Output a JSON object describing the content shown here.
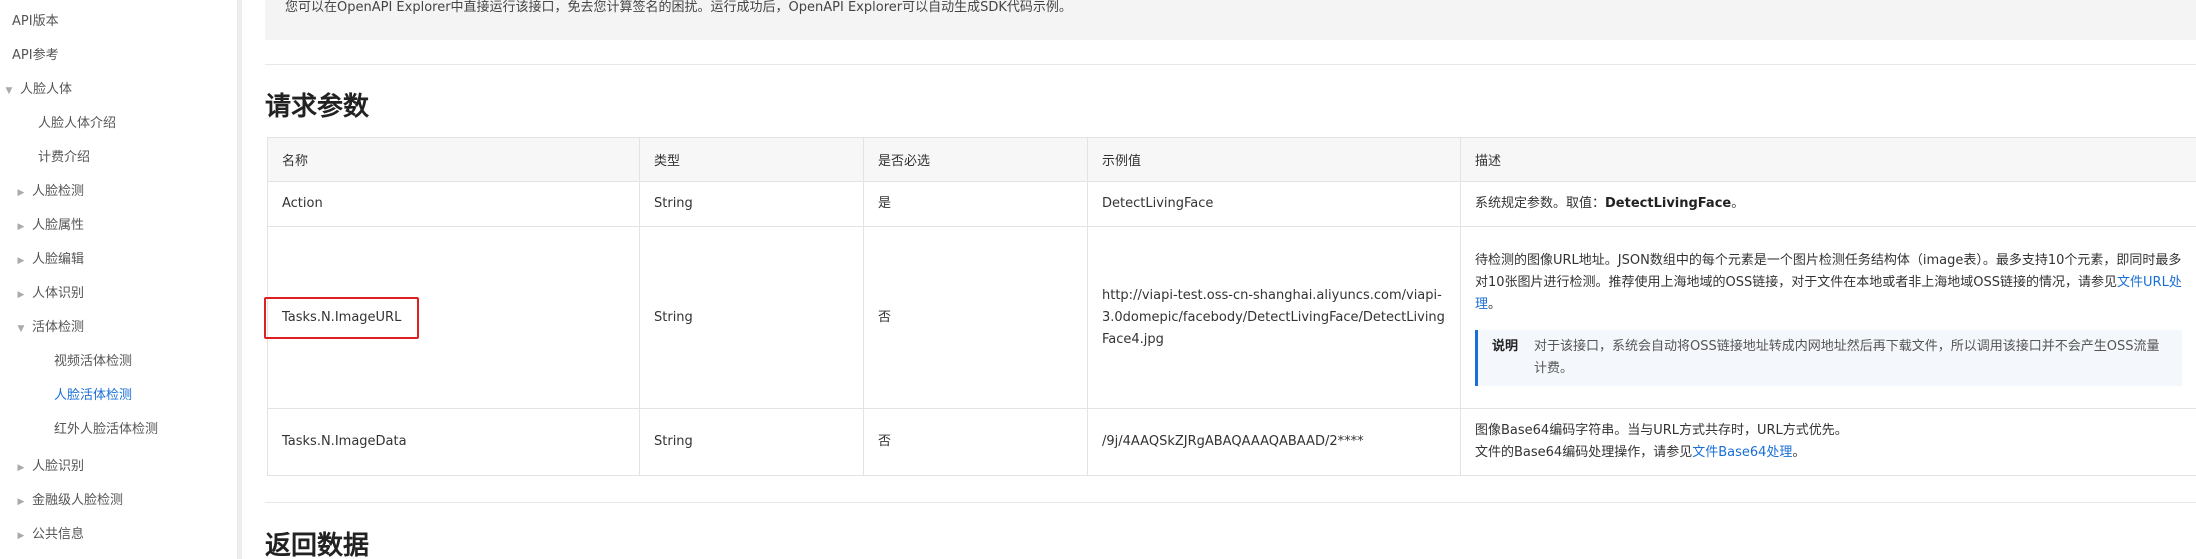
{
  "sidebar": {
    "items": [
      {
        "label": "API版本",
        "level": 0,
        "caret": ""
      },
      {
        "label": "API参考",
        "level": 0,
        "caret": ""
      },
      {
        "label": "人脸人体",
        "level": 0,
        "caret": "▼"
      },
      {
        "label": "人脸人体介绍",
        "level": 1,
        "caret": ""
      },
      {
        "label": "计费介绍",
        "level": 1,
        "caret": ""
      },
      {
        "label": "人脸检测",
        "level": 1,
        "caret": "▶"
      },
      {
        "label": "人脸属性",
        "level": 1,
        "caret": "▶"
      },
      {
        "label": "人脸编辑",
        "level": 1,
        "caret": "▶"
      },
      {
        "label": "人体识别",
        "level": 1,
        "caret": "▶"
      },
      {
        "label": "活体检测",
        "level": 1,
        "caret": "▼"
      },
      {
        "label": "视频活体检测",
        "level": 2,
        "caret": ""
      },
      {
        "label": "人脸活体检测",
        "level": 2,
        "caret": "",
        "active": true
      },
      {
        "label": "红外人脸活体检测",
        "level": 2,
        "caret": ""
      },
      {
        "label": "人脸识别",
        "level": 1,
        "caret": "▶"
      },
      {
        "label": "金融级人脸检测",
        "level": 1,
        "caret": "▶"
      },
      {
        "label": "公共信息",
        "level": 1,
        "caret": "▶"
      }
    ]
  },
  "main": {
    "intro_note": "您可以在OpenAPI Explorer中直接运行该接口，免去您计算签名的困扰。运行成功后，OpenAPI Explorer可以自动生成SDK代码示例。",
    "request_title": "请求参数",
    "response_title": "返回数据",
    "table": {
      "headers": [
        "名称",
        "类型",
        "是否必选",
        "示例值",
        "描述"
      ],
      "rows": [
        {
          "name": "Action",
          "type": "String",
          "required": "是",
          "example": "DetectLivingFace",
          "desc_prefix": "系统规定参数。取值：",
          "desc_bold": "DetectLivingFace",
          "desc_suffix": "。"
        },
        {
          "name": "Tasks.N.ImageURL",
          "type": "String",
          "required": "否",
          "example": "http://viapi-test.oss-cn-shanghai.aliyuncs.com/viapi-3.0domepic/facebody/DetectLivingFace/DetectLivingFace4.jpg",
          "desc_text": "待检测的图像URL地址。JSON数组中的每个元素是一个图片检测任务结构体（image表）。最多支持10个元素，即同时最多对10张图片进行检测。推荐使用上海地域的OSS链接，对于文件在本地或者非上海地域OSS链接的情况，请参见",
          "desc_link": "文件URL处理",
          "desc_end": "。",
          "note_label": "说明",
          "note_text": "对于该接口，系统会自动将OSS链接地址转成内网地址然后再下载文件，所以调用该接口并不会产生OSS流量计费。"
        },
        {
          "name": "Tasks.N.ImageData",
          "type": "String",
          "required": "否",
          "example": "/9j/4AAQSkZJRgABAQAAAQABAAD/2****",
          "desc_line1": "图像Base64编码字符串。当与URL方式共存时，URL方式优先。",
          "desc_line2_prefix": "文件的Base64编码处理操作，请参见",
          "desc_link": "文件Base64处理",
          "desc_end": "。"
        }
      ]
    }
  },
  "colors": {
    "accent": "#1a6fd6",
    "highlight_box": "#e02020"
  }
}
